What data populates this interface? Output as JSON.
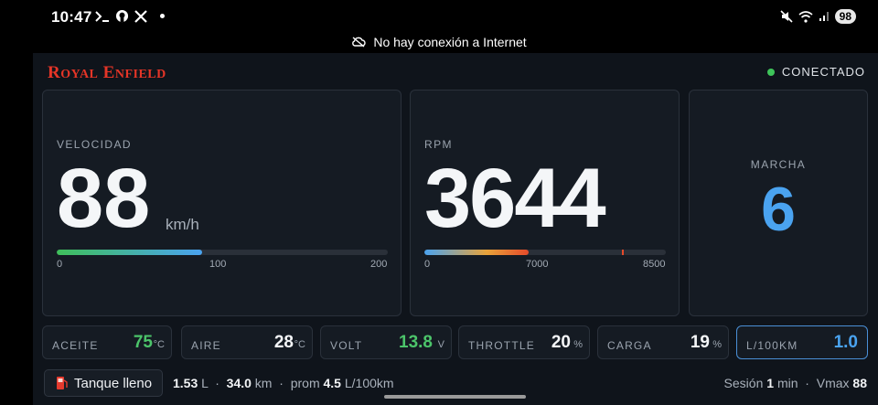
{
  "status_bar": {
    "time": "10:47",
    "left_icons": [
      "terminal-icon",
      "github-icon",
      "x-icon",
      "dot-icon"
    ],
    "right_icons": [
      "mute-icon",
      "wifi-icon",
      "signal-icon"
    ],
    "battery": "98"
  },
  "offline_banner": {
    "text": "No hay conexión a Internet"
  },
  "header": {
    "brand_first": "R",
    "brand_rest1": "OYAL",
    "brand_e": "E",
    "brand_rest2": "NFIELD",
    "connection": "CONECTADO",
    "colors": {
      "brand": "#e53527",
      "connected": "#3ec45a"
    }
  },
  "speed": {
    "label": "VELOCIDAD",
    "value": "88",
    "unit": "km/h",
    "bar_fraction": 0.44,
    "ticks": [
      "0",
      "100",
      "200"
    ]
  },
  "rpm": {
    "label": "RPM",
    "value": "3644",
    "bar_fraction": 0.43,
    "redline_fraction": 0.82,
    "ticks": [
      "0",
      "7000",
      "8500"
    ]
  },
  "gear": {
    "label": "MARCHA",
    "value": "6",
    "color": "#4aa3f0"
  },
  "metrics": [
    {
      "label": "ACEITE",
      "value": "75",
      "unit": "°C",
      "color": "#4cc46a"
    },
    {
      "label": "AIRE",
      "value": "28",
      "unit": "°C",
      "color": "#f4f6f8"
    },
    {
      "label": "VOLT",
      "value": "13.8",
      "unit": "V",
      "color": "#4cc46a"
    },
    {
      "label": "THROTTLE",
      "value": "20",
      "unit": "%",
      "color": "#f4f6f8"
    },
    {
      "label": "CARGA",
      "value": "19",
      "unit": "%",
      "color": "#f4f6f8"
    },
    {
      "label": "L/100KM",
      "value": "1.0",
      "unit": "",
      "color": "#4aa3f0"
    }
  ],
  "footer": {
    "tank_button": "Tanque lleno",
    "liters": "1.53",
    "liters_unit": "L",
    "km": "34.0",
    "km_unit": "km",
    "sep": "·",
    "avg_label": "prom",
    "avg_value": "4.5",
    "avg_unit": "L/100km",
    "session_label": "Sesión",
    "session_value": "1",
    "session_unit": "min",
    "vmax_label": "Vmax",
    "vmax_value": "88"
  }
}
